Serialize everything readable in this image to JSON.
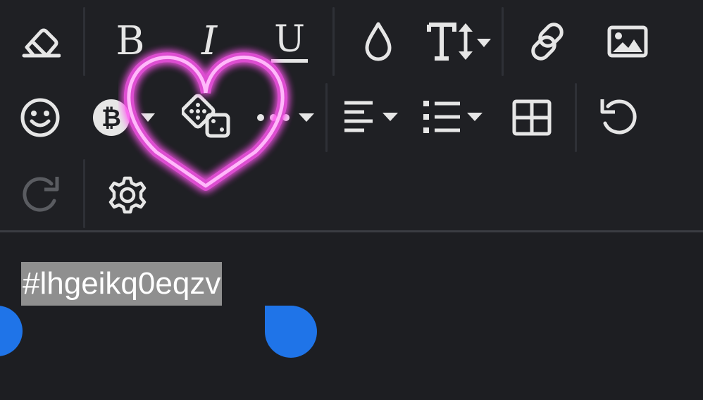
{
  "toolbar": {
    "rows": [
      [
        "eraser-icon",
        "bold-icon",
        "italic-icon",
        "underline-icon",
        "color-drop-icon",
        "text-size-icon",
        "link-icon",
        "image-icon"
      ],
      [
        "emoji-icon",
        "bitcoin-icon",
        "dice-icon",
        "more-dots-icon",
        "align-icon",
        "list-icon",
        "table-icon",
        "undo-icon"
      ],
      [
        "redo-icon",
        "settings-icon"
      ]
    ],
    "labels": {
      "bold": "B",
      "italic": "I",
      "underline": "U",
      "text_size": "T"
    },
    "colors": {
      "icon": "#e6e6e6",
      "icon_disabled": "#5a5c61",
      "divider": "#2e3036",
      "background": "#1f2024"
    }
  },
  "editor": {
    "selected_text": "#lhgeikq0eqzv",
    "selection_highlight": "#8f8f8f",
    "handle_color": "#1f74e8"
  },
  "overlay": {
    "heart_color": "#ff57f0"
  }
}
